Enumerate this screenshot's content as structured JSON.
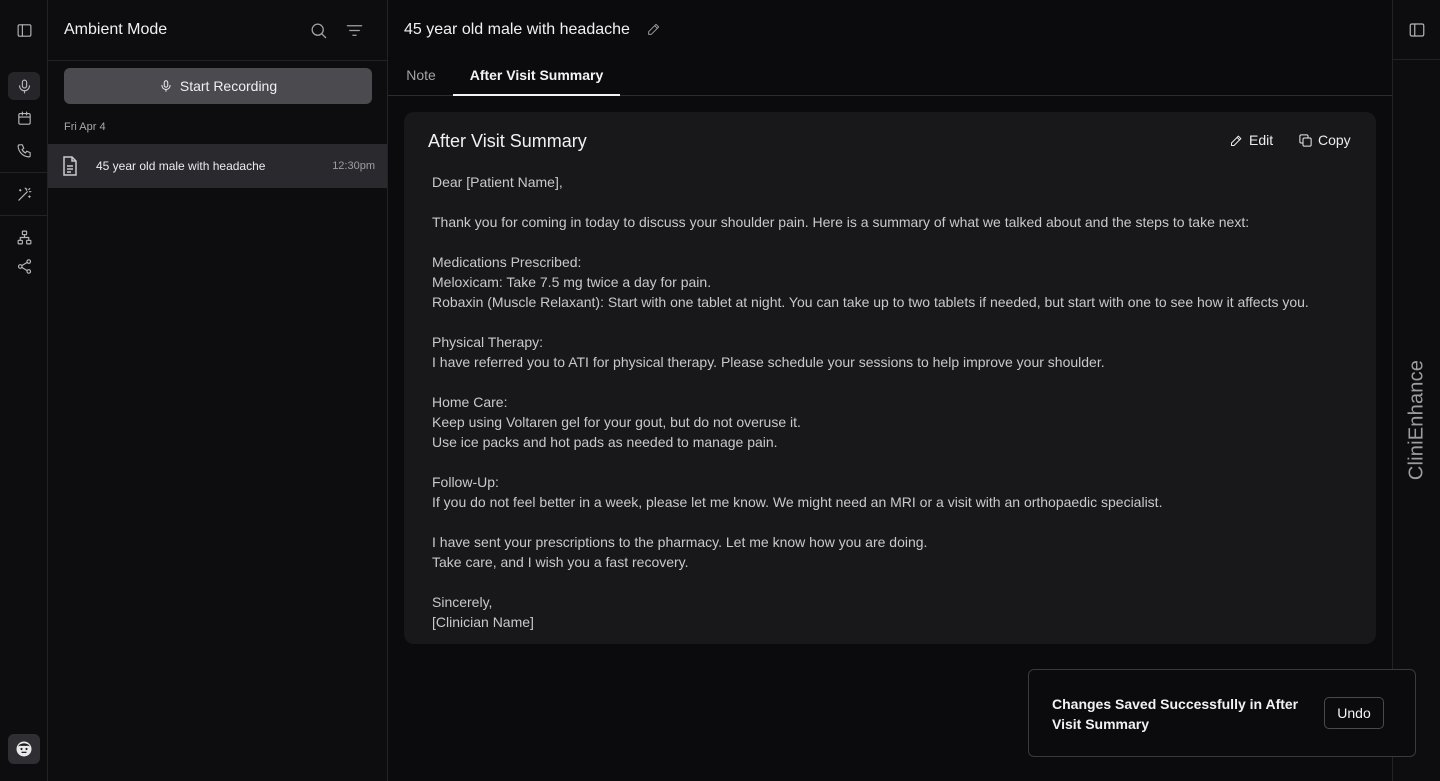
{
  "sidebar": {
    "title": "Ambient Mode",
    "start_recording_label": "Start Recording",
    "date_group": "Fri Apr 4",
    "sessions": [
      {
        "title": "45 year old male with headache",
        "time": "12:30pm"
      }
    ]
  },
  "main": {
    "title": "45 year old male with headache",
    "tabs": [
      {
        "label": "Note",
        "active": false
      },
      {
        "label": "After Visit Summary",
        "active": true
      }
    ],
    "card": {
      "title": "After Visit Summary",
      "edit_label": "Edit",
      "copy_label": "Copy",
      "lines": [
        "Dear [Patient Name],",
        "",
        "Thank you for coming in today to discuss your shoulder pain. Here is a summary of what we talked about and the steps to take next:",
        "",
        "Medications Prescribed:",
        "Meloxicam: Take 7.5 mg twice a day for pain.",
        "Robaxin (Muscle Relaxant): Start with one tablet at night. You can take up to two tablets if needed, but start with one to see how it affects you.",
        "",
        "Physical Therapy:",
        "I have referred you to ATI for physical therapy. Please schedule your sessions to help improve your shoulder.",
        "",
        "Home Care:",
        "Keep using Voltaren gel for your gout, but do not overuse it.",
        "Use ice packs and hot pads as needed to manage pain.",
        "",
        "Follow-Up:",
        "If you do not feel better in a week, please let me know. We might need an MRI or a visit with an orthopaedic specialist.",
        "",
        "I have sent your prescriptions to the pharmacy. Let me know how you are doing.",
        "Take care, and I wish you a fast recovery.",
        "",
        "Sincerely,",
        "[Clinician Name]"
      ]
    }
  },
  "brand": "CliniEnhance",
  "toast": {
    "message": "Changes Saved Successfully in After Visit Summary",
    "undo_label": "Undo"
  },
  "icons": {
    "rail": [
      "sidebar-toggle-icon",
      "microphone-icon",
      "calendar-icon",
      "phone-icon",
      "magic-wand-icon",
      "sitemap-icon",
      "share-icon",
      "avatar-icon"
    ],
    "header": [
      "search-icon",
      "filter-icon",
      "pencil-icon",
      "copy-icon",
      "document-icon",
      "panel-right-icon"
    ]
  },
  "colors": {
    "background": "#0b0b0d",
    "card": "#18181b",
    "selected_row": "#2a2a2e",
    "record_button": "#4a4a4f"
  }
}
